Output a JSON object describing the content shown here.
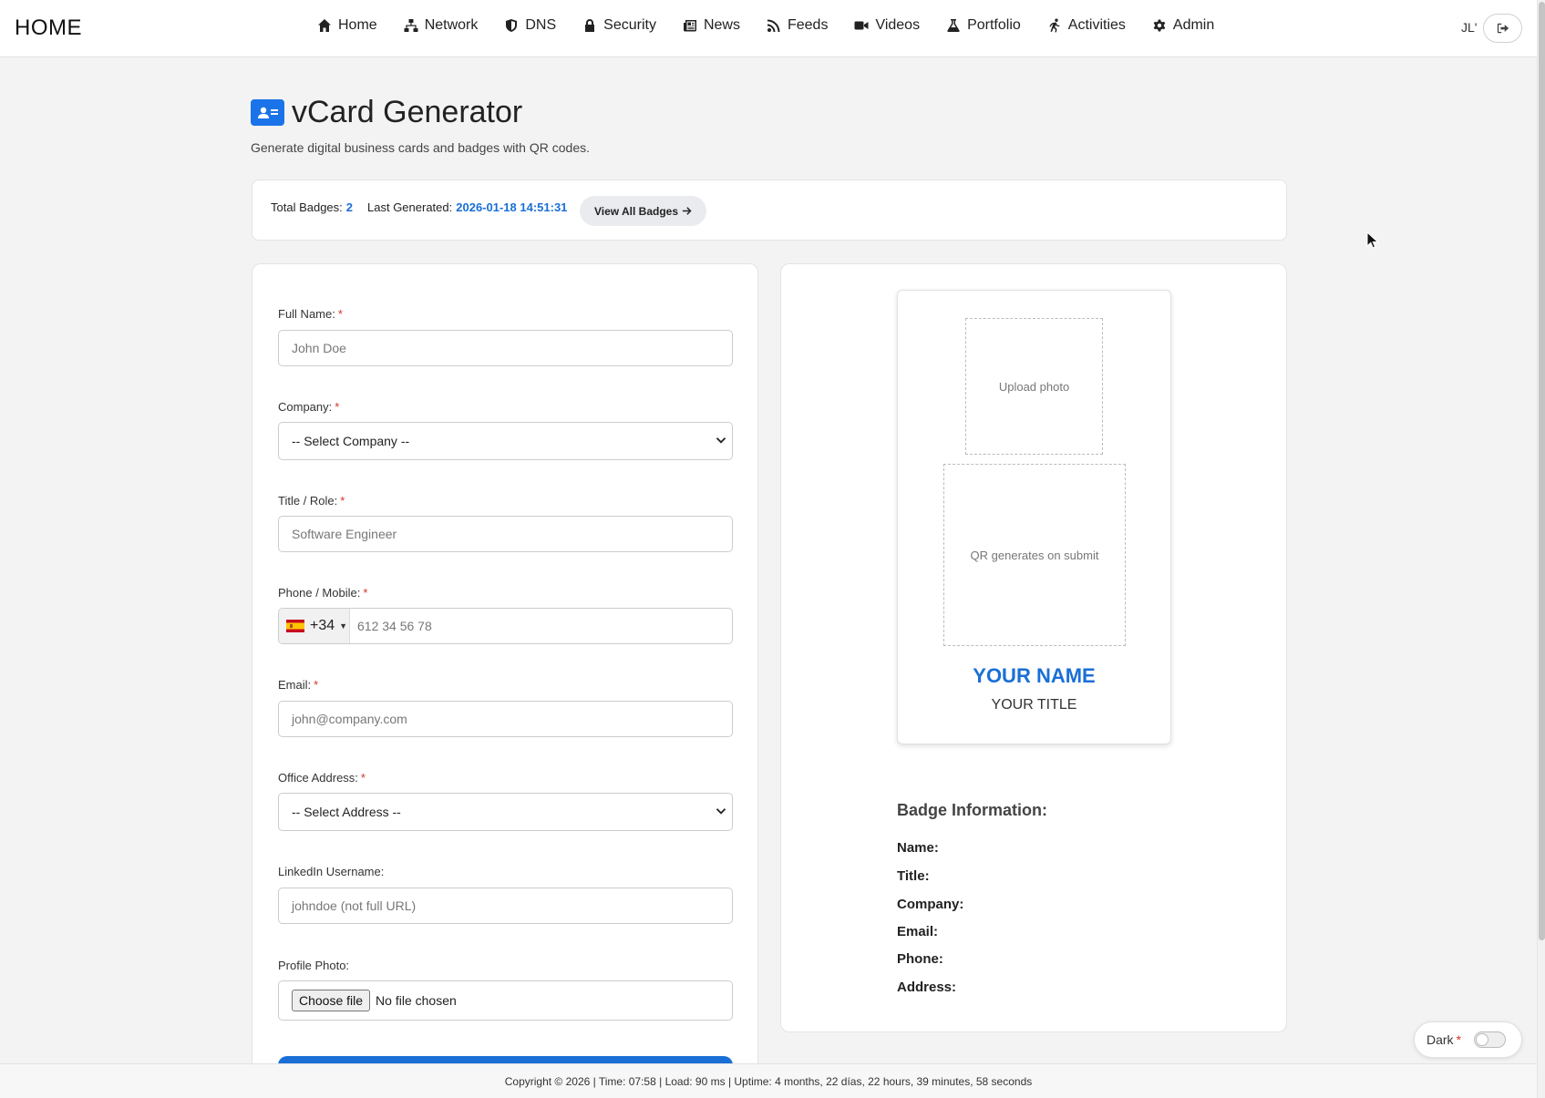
{
  "brand": "HOME",
  "nav": [
    {
      "label": "Home",
      "icon": "home-icon"
    },
    {
      "label": "Network",
      "icon": "network-icon"
    },
    {
      "label": "DNS",
      "icon": "shield-icon"
    },
    {
      "label": "Security",
      "icon": "lock-icon"
    },
    {
      "label": "News",
      "icon": "newspaper-icon"
    },
    {
      "label": "Feeds",
      "icon": "rss-icon"
    },
    {
      "label": "Videos",
      "icon": "video-camera-icon"
    },
    {
      "label": "Portfolio",
      "icon": "flask-icon"
    },
    {
      "label": "Activities",
      "icon": "running-icon"
    },
    {
      "label": "Admin",
      "icon": "gear-icon"
    }
  ],
  "user": {
    "initials": "JL'"
  },
  "header": {
    "title": "vCard Generator",
    "subtitle": "Generate digital business cards and badges with QR codes."
  },
  "stats": {
    "total_label": "Total Badges:",
    "total_value": "2",
    "last_label": "Last Generated:",
    "last_value": "2026-01-18 14:51:31",
    "view_all": "View All Badges"
  },
  "form": {
    "full_name": {
      "label": "Full Name:",
      "placeholder": "John Doe"
    },
    "company": {
      "label": "Company:",
      "selected": "-- Select Company --"
    },
    "title": {
      "label": "Title / Role:",
      "placeholder": "Software Engineer"
    },
    "phone": {
      "label": "Phone / Mobile:",
      "dial_code": "+34",
      "placeholder": "612 34 56 78"
    },
    "email": {
      "label": "Email:",
      "placeholder": "john@company.com"
    },
    "address": {
      "label": "Office Address:",
      "selected": "-- Select Address --"
    },
    "linkedin": {
      "label": "LinkedIn Username:",
      "placeholder": "johndoe (not full URL)"
    },
    "photo": {
      "label": "Profile Photo:",
      "button": "Choose file",
      "status": "No file chosen"
    },
    "required_mark": "*"
  },
  "preview": {
    "photo_placeholder": "Upload photo",
    "qr_placeholder": "QR generates on submit",
    "name": "YOUR NAME",
    "title": "YOUR TITLE",
    "info_heading": "Badge Information:",
    "info_fields": [
      "Name:",
      "Title:",
      "Company:",
      "Email:",
      "Phone:",
      "Address:"
    ]
  },
  "footer": "Copyright © 2026 | Time: 07:58 | Load: 90 ms | Uptime: 4 months, 22 días, 22 hours, 39 minutes, 58 seconds",
  "dark_toggle": {
    "label": "Dark",
    "mark": "*"
  },
  "colors": {
    "accent": "#1a6fd6",
    "required": "#d93025"
  }
}
